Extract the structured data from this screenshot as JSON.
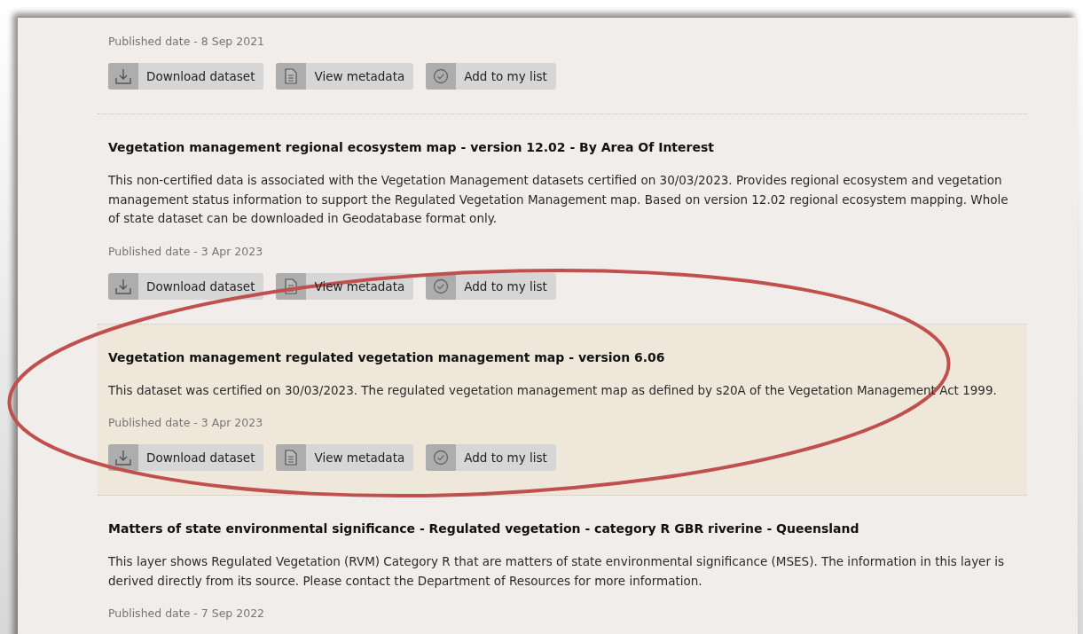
{
  "results": [
    {
      "published": "Published date - 8 Sep 2021",
      "highlighted": false,
      "buttons": [
        {
          "kind": "download",
          "label": "Download dataset"
        },
        {
          "kind": "metadata",
          "label": "View metadata"
        },
        {
          "kind": "list",
          "label": "Add to my list"
        }
      ]
    },
    {
      "title": "Vegetation management regional ecosystem map - version 12.02 - By Area Of Interest",
      "description": "This non-certified data is associated with the Vegetation Management datasets certified on 30/03/2023. Provides regional ecosystem and vegetation management status information to support the Regulated Vegetation Management map. Based on version 12.02 regional ecosystem mapping. Whole of state dataset can be downloaded in Geodatabase format only.",
      "published": "Published date - 3 Apr 2023",
      "highlighted": false,
      "buttons": [
        {
          "kind": "download",
          "label": "Download dataset"
        },
        {
          "kind": "metadata",
          "label": "View metadata"
        },
        {
          "kind": "list",
          "label": "Add to my list"
        }
      ]
    },
    {
      "title": "Vegetation management regulated vegetation management map - version 6.06",
      "description": "This dataset was certified on 30/03/2023. The regulated vegetation management map as defined by s20A of the Vegetation Management Act 1999.",
      "published": "Published date - 3 Apr 2023",
      "highlighted": true,
      "buttons": [
        {
          "kind": "download",
          "label": "Download dataset"
        },
        {
          "kind": "metadata",
          "label": "View metadata"
        },
        {
          "kind": "list",
          "label": "Add to my list"
        }
      ]
    },
    {
      "title": "Matters of state environmental significance - Regulated vegetation - category R GBR riverine - Queensland",
      "description": "This layer shows Regulated Vegetation (RVM) Category R that are matters of state environmental significance (MSES). The information in this layer is derived directly from its source. Please contact the Department of Resources for more information.",
      "published": "Published date - 7 Sep 2022",
      "highlighted": false
    }
  ],
  "annotation": {
    "kind": "ellipse",
    "color": "#c0504d"
  }
}
